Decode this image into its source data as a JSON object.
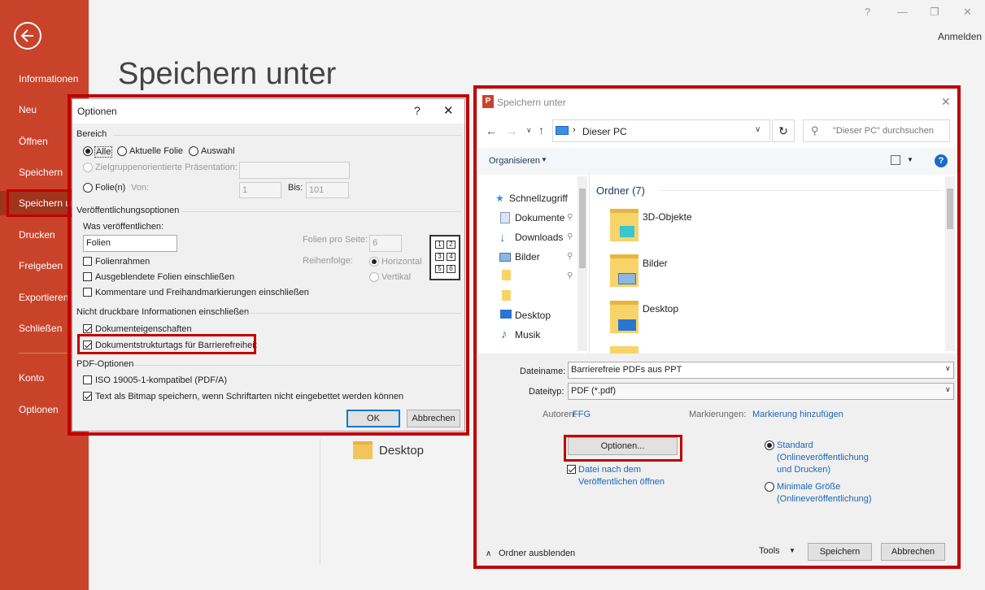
{
  "sidebar": {
    "items": [
      {
        "label": "Informationen"
      },
      {
        "label": "Neu"
      },
      {
        "label": "Öffnen"
      },
      {
        "label": "Speichern"
      },
      {
        "label": "Speichern unter"
      },
      {
        "label": "Drucken"
      },
      {
        "label": "Freigeben"
      },
      {
        "label": "Exportieren"
      },
      {
        "label": "Schließen"
      },
      {
        "label": "Konto"
      },
      {
        "label": "Optionen"
      }
    ]
  },
  "window": {
    "help": "?",
    "minimize": "—",
    "restore": "❐",
    "close": "✕",
    "signin": "Anmelden"
  },
  "page": {
    "title": "Speichern unter",
    "background_folder": "Desktop"
  },
  "options_dialog": {
    "title": "Optionen",
    "help": "?",
    "close": "✕",
    "range": {
      "header": "Bereich",
      "all": "Alle",
      "current": "Aktuelle Folie",
      "selection": "Auswahl",
      "custom_show": "Zielgruppenorientierte Präsentation:",
      "slides": "Folie(n)",
      "from_label": "Von:",
      "from_value": "1",
      "to_label": "Bis:",
      "to_value": "101"
    },
    "publish": {
      "header": "Veröffentlichungsoptionen",
      "what_label": "Was veröffentlichen:",
      "what_value": "Folien",
      "per_page_label": "Folien pro Seite:",
      "per_page_value": "6",
      "order_label": "Reihenfolge:",
      "horizontal": "Horizontal",
      "vertical": "Vertikal",
      "frame": "Folienrahmen",
      "hidden": "Ausgeblendete Folien einschließen",
      "comments": "Kommentare und Freihandmarkierungen einschließen",
      "layout_numbers": [
        "1",
        "2",
        "3",
        "4",
        "5",
        "6"
      ]
    },
    "nonprint": {
      "header": "Nicht druckbare Informationen einschließen",
      "doc_props": "Dokumenteigenschaften",
      "struct_tags": "Dokumentstrukturtags für Barrierefreiheit"
    },
    "pdf": {
      "header": "PDF-Optionen",
      "iso": "ISO 19005-1-kompatibel (PDF/A)",
      "bitmap": "Text als Bitmap speichern, wenn Schriftarten nicht eingebettet werden können"
    },
    "ok": "OK",
    "cancel": "Abbrechen"
  },
  "save_dialog": {
    "title": "Speichern unter",
    "address": "Dieser PC",
    "search_placeholder": "\"Dieser PC\" durchsuchen",
    "organize": "Organisieren",
    "nav": [
      "Schnellzugriff",
      "Dokumente",
      "Downloads",
      "Bilder",
      "",
      "",
      "Desktop",
      "Musik"
    ],
    "section": "Ordner (7)",
    "folders": [
      "3D-Objekte",
      "Bilder",
      "Desktop"
    ],
    "filename_label": "Dateiname:",
    "filename_value": "Barrierefreie PDFs aus PPT",
    "filetype_label": "Dateityp:",
    "filetype_value": "PDF (*.pdf)",
    "authors_label": "Autoren:",
    "authors_value": "FFG",
    "tags_label": "Markierungen:",
    "tags_value": "Markierung hinzufügen",
    "options_button": "Optionen...",
    "open_after": "Datei nach dem Veröffentlichen öffnen",
    "standard": "Standard (Onlineveröffentlichung und Drucken)",
    "minimal": "Minimale Größe (Onlineveröffentlichung)",
    "hide_folders": "Ordner ausblenden",
    "tools": "Tools",
    "save": "Speichern",
    "cancel": "Abbrechen"
  },
  "colors": {
    "accent": "#c9432a",
    "highlight": "#c00000",
    "link": "#1a66b5"
  }
}
